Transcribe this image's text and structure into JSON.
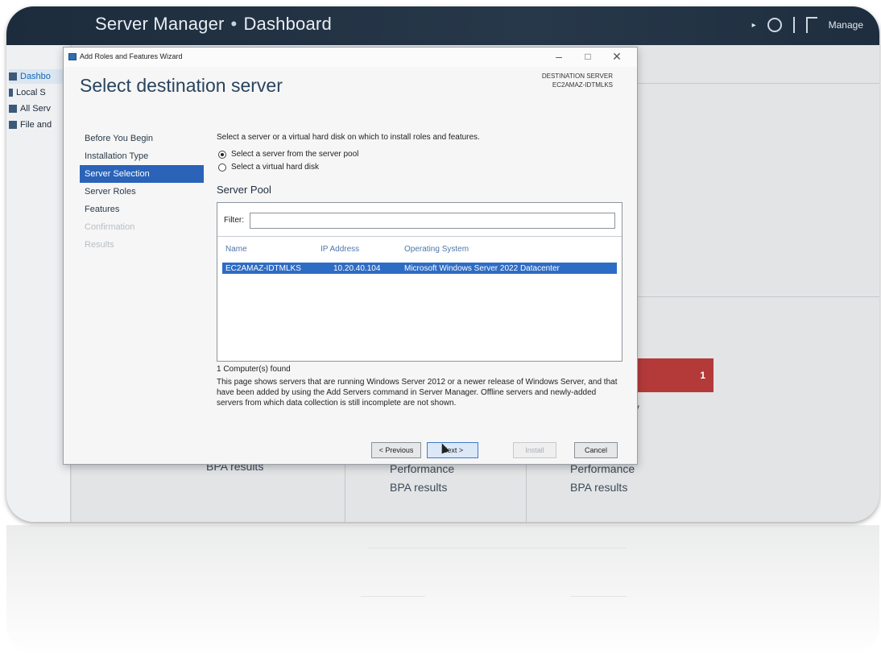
{
  "server_manager": {
    "title": "Server Manager",
    "separator": "•",
    "page": "Dashboard",
    "manage_label": "Manage",
    "sidebar": [
      {
        "label": "Dashbo",
        "active": true
      },
      {
        "label": "Local S",
        "active": false
      },
      {
        "label": "All Serv",
        "active": false
      },
      {
        "label": "File and",
        "active": false
      }
    ],
    "alert_count": "1",
    "partial_label": "ty",
    "tiles": {
      "bpa_left": "BPA results",
      "perf_mid": "Performance",
      "bpa_mid": "BPA results",
      "perf_right": "Performance",
      "bpa_right": "BPA results"
    },
    "colors": {
      "header_bg": "#24374a",
      "alert_red": "#b43a3a",
      "selection_blue": "#2d6cc4"
    }
  },
  "wizard": {
    "window_title": "Add Roles and Features Wizard",
    "controls": {
      "minimize": "–",
      "maximize": "□",
      "close": "✕"
    },
    "heading": "Select destination server",
    "destination_label": "DESTINATION SERVER",
    "destination_server": "EC2AMAZ-IDTMLKS",
    "nav": [
      {
        "label": "Before You Begin",
        "state": "normal"
      },
      {
        "label": "Installation Type",
        "state": "normal"
      },
      {
        "label": "Server Selection",
        "state": "active"
      },
      {
        "label": "Server Roles",
        "state": "normal"
      },
      {
        "label": "Features",
        "state": "normal"
      },
      {
        "label": "Confirmation",
        "state": "disabled"
      },
      {
        "label": "Results",
        "state": "disabled"
      }
    ],
    "instruction": "Select a server or a virtual hard disk on which to install roles and features.",
    "options": [
      {
        "label": "Select a server from the server pool",
        "selected": true
      },
      {
        "label": "Select a virtual hard disk",
        "selected": false
      }
    ],
    "pool_heading": "Server Pool",
    "filter_label": "Filter:",
    "filter_value": "",
    "columns": [
      "Name",
      "IP Address",
      "Operating System"
    ],
    "rows": [
      {
        "name": "EC2AMAZ-IDTMLKS",
        "ip": "10.20.40.104",
        "os": "Microsoft Windows Server 2022 Datacenter",
        "selected": true
      }
    ],
    "found_text": "1 Computer(s) found",
    "info_text": "This page shows servers that are running Windows Server 2012 or a newer release of Windows Server, and that have been added by using the Add Servers command in Server Manager. Offline servers and newly-added servers from which data collection is still incomplete are not shown.",
    "buttons": {
      "previous": "< Previous",
      "next": "Next >",
      "install": "Install",
      "cancel": "Cancel"
    }
  }
}
